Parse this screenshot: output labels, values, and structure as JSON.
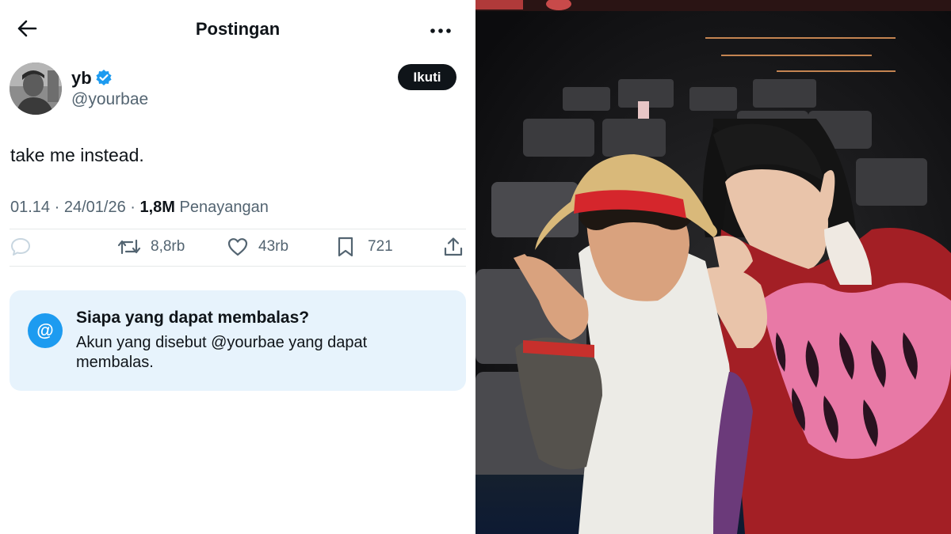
{
  "header": {
    "title": "Postingan",
    "back_icon": "arrow-left-icon",
    "more_icon": "more-horizontal-icon"
  },
  "author": {
    "display_name": "yb",
    "handle": "@yourbae",
    "verified_icon": "verified-badge-icon",
    "verified_color": "#1d9bf0",
    "follow_label": "Ikuti"
  },
  "tweet": {
    "text": "take me instead.",
    "time": "01.14",
    "date": "24/01/26",
    "views_count": "1,8M",
    "views_label": "Penayangan"
  },
  "actions": {
    "reply_icon": "reply-icon",
    "retweet_count": "8,8rb",
    "like_count": "43rb",
    "bookmark_count": "721",
    "share_icon": "share-icon"
  },
  "reply_restriction": {
    "icon_text": "@",
    "title": "Siapa yang dapat membalas?",
    "description": "Akun yang disebut @yourbae yang dapat membalas."
  },
  "colors": {
    "text": "#0f1419",
    "secondary": "#536471",
    "accent": "#1d9bf0",
    "card_bg": "#e7f3fc"
  }
}
